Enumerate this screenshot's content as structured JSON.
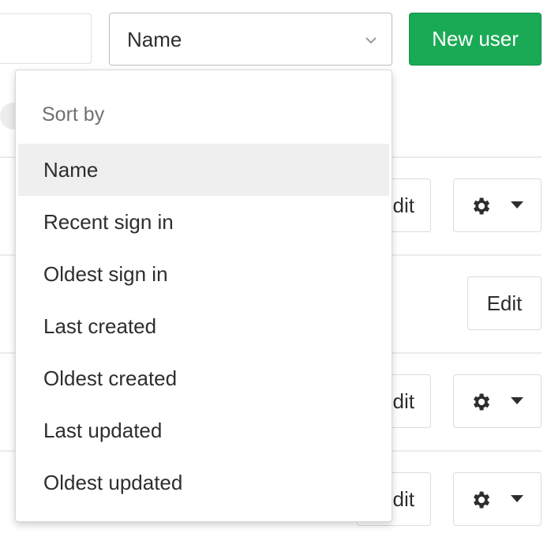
{
  "toolbar": {
    "sort_selected": "Name",
    "new_user_label": "New user"
  },
  "dropdown": {
    "header": "Sort by",
    "items": [
      "Name",
      "Recent sign in",
      "Oldest sign in",
      "Last created",
      "Oldest created",
      "Last updated",
      "Oldest updated"
    ],
    "active_item": "Name"
  },
  "rows": {
    "edit_label": "Edit",
    "edit_partial_label": "dit"
  },
  "colors": {
    "primary_green": "#1aaa55",
    "active_item_bg": "#efefef",
    "muted_text": "#707070"
  }
}
